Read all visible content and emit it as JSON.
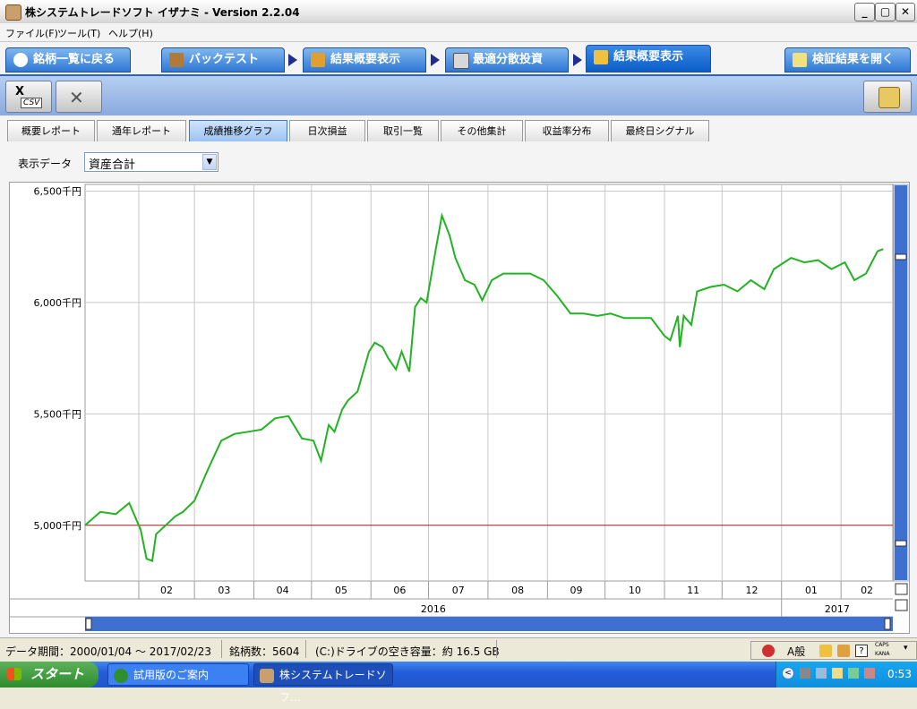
{
  "window": {
    "title": "株システムトレードソフト イザナミ - Version 2.2.04"
  },
  "menu": [
    "ファイル(F)",
    "ツール(T)",
    "ヘルプ(H)"
  ],
  "bigtabs": {
    "back": "銘柄一覧に戻る",
    "backtest": "バックテスト",
    "summary1": "結果概要表示",
    "optimal": "最適分散投資",
    "summary2": "結果概要表示",
    "open": "検証結果を開く"
  },
  "toolbar": {
    "csv_label": "CSV"
  },
  "subtabs": [
    "概要レポート",
    "通年レポート",
    "成績推移グラフ",
    "日次損益",
    "取引一覧",
    "その他集計",
    "収益率分布",
    "最終日シグナル"
  ],
  "active_subtab_index": 2,
  "display": {
    "label": "表示データ",
    "selected": "資産合計"
  },
  "status": {
    "data_period": "データ期間：2000/01/04 〜 2017/02/23",
    "symbol_count": "銘柄数：5604",
    "drive": "(C:)ドライブの空き容量：約 16.5 GB"
  },
  "taskbar": {
    "start": "スタート",
    "item1": "試用版のご案内",
    "item2": "株システムトレードソフ...",
    "clock": "0:53"
  },
  "ime": {
    "mode": "A般",
    "caps": "CAPS",
    "kana": "KANA"
  },
  "chart_data": {
    "type": "line",
    "title": "",
    "ylabel": "",
    "ylim": [
      4750,
      6530
    ],
    "yticks": [
      5000,
      5500,
      6000,
      6500
    ],
    "ytick_labels": [
      "5,000千円",
      "5,500千円",
      "6,000千円",
      "6,500千円"
    ],
    "month_labels": [
      "02",
      "03",
      "04",
      "05",
      "06",
      "07",
      "08",
      "09",
      "10",
      "11",
      "12",
      "01",
      "02"
    ],
    "year_labels": [
      "2016",
      "2017"
    ],
    "baseline": 5000,
    "colors": {
      "line": "#22b322",
      "baseline": "#b22222",
      "grid": "#c8c8c8"
    },
    "series": [
      {
        "x": [
          "2016-01-04",
          "2016-01-12",
          "2016-01-20",
          "2016-01-27",
          "2016-02-02",
          "2016-02-05",
          "2016-02-08",
          "2016-02-10",
          "2016-02-15",
          "2016-02-20",
          "2016-02-24",
          "2016-03-01",
          "2016-03-08",
          "2016-03-15",
          "2016-03-22",
          "2016-03-29",
          "2016-04-05",
          "2016-04-12",
          "2016-04-19",
          "2016-04-26",
          "2016-05-02",
          "2016-05-06",
          "2016-05-10",
          "2016-05-13",
          "2016-05-17",
          "2016-05-20",
          "2016-05-25",
          "2016-05-31",
          "2016-06-03",
          "2016-06-07",
          "2016-06-10",
          "2016-06-14",
          "2016-06-17",
          "2016-06-21",
          "2016-06-24",
          "2016-06-27",
          "2016-06-30",
          "2016-07-05",
          "2016-07-08",
          "2016-07-12",
          "2016-07-15",
          "2016-07-20",
          "2016-07-25",
          "2016-07-29",
          "2016-08-03",
          "2016-08-09",
          "2016-08-16",
          "2016-08-23",
          "2016-08-30",
          "2016-09-06",
          "2016-09-13",
          "2016-09-20",
          "2016-09-27",
          "2016-10-04",
          "2016-10-11",
          "2016-10-18",
          "2016-10-25",
          "2016-11-01",
          "2016-11-04",
          "2016-11-08",
          "2016-11-09",
          "2016-11-11",
          "2016-11-15",
          "2016-11-18",
          "2016-11-25",
          "2016-12-02",
          "2016-12-09",
          "2016-12-16",
          "2016-12-23",
          "2016-12-28",
          "2017-01-06",
          "2017-01-13",
          "2017-01-20",
          "2017-01-27",
          "2017-02-03",
          "2017-02-08",
          "2017-02-14",
          "2017-02-20",
          "2017-02-23"
        ],
        "y": [
          5000,
          5060,
          5050,
          5100,
          4980,
          4850,
          4840,
          4960,
          5000,
          5040,
          5060,
          5110,
          5250,
          5380,
          5410,
          5420,
          5430,
          5480,
          5490,
          5390,
          5380,
          5290,
          5450,
          5420,
          5520,
          5560,
          5600,
          5780,
          5820,
          5800,
          5750,
          5700,
          5780,
          5690,
          5980,
          6020,
          6000,
          6250,
          6390,
          6300,
          6200,
          6100,
          6080,
          6010,
          6100,
          6130,
          6130,
          6130,
          6100,
          6030,
          5950,
          5950,
          5940,
          5950,
          5930,
          5930,
          5930,
          5850,
          5830,
          5940,
          5800,
          5940,
          5900,
          6050,
          6070,
          6080,
          6050,
          6100,
          6060,
          6150,
          6200,
          6180,
          6190,
          6150,
          6180,
          6100,
          6130,
          6230,
          6240
        ]
      }
    ]
  }
}
